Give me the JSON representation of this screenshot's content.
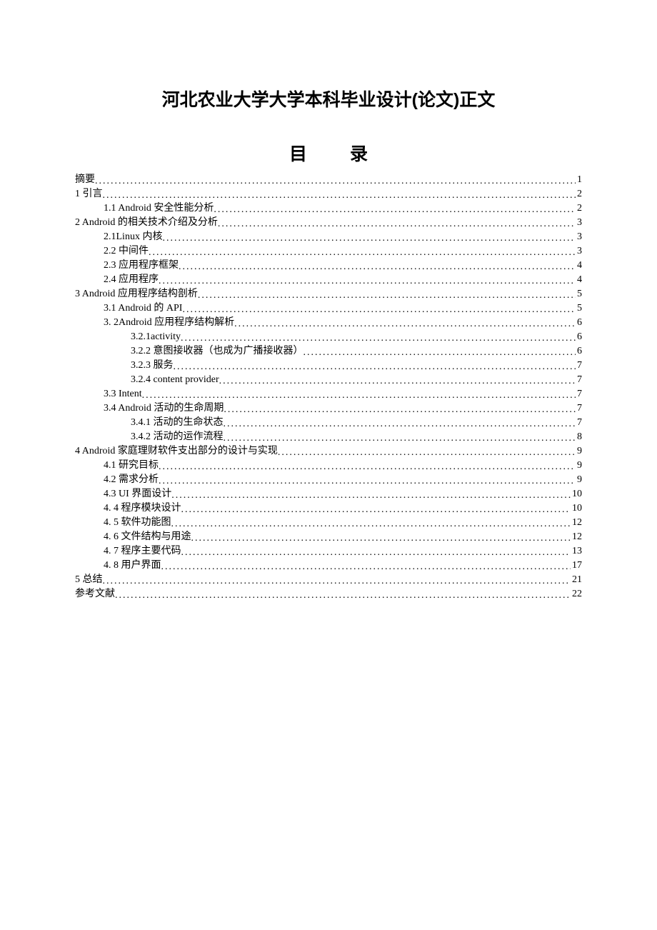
{
  "title": "河北农业大学大学本科毕业设计(论文)正文",
  "toc_heading_left": "目",
  "toc_heading_right": "录",
  "toc": [
    {
      "level": 0,
      "label": "摘要",
      "page": "1"
    },
    {
      "level": 0,
      "label": "1  引言",
      "page": "2"
    },
    {
      "level": 1,
      "label": "1.1 Android 安全性能分析 ",
      "page": "2"
    },
    {
      "level": 0,
      "label": "2 Android 的相关技术介绍及分析 ",
      "page": "3"
    },
    {
      "level": 1,
      "label": "2.1Linux 内核",
      "page": "3"
    },
    {
      "level": 1,
      "label": "2.2 中间件",
      "page": "3"
    },
    {
      "level": 1,
      "label": "2.3  应用程序框架",
      "page": "4"
    },
    {
      "level": 1,
      "label": "2.4 应用程序",
      "page": "4"
    },
    {
      "level": 0,
      "label": "3 Android 应用程序结构剖析 ",
      "page": "5"
    },
    {
      "level": 1,
      "label": "3.1 Android 的 API",
      "page": "5"
    },
    {
      "level": 1,
      "label": "3. 2Android 应用程序结构解析",
      "page": "6"
    },
    {
      "level": 2,
      "label": "3.2.1activity",
      "page": "6"
    },
    {
      "level": 2,
      "label": "3.2.2 意图接收器（也成为广播接收器）",
      "page": "6"
    },
    {
      "level": 2,
      "label": "3.2.3 服务",
      "page": "7"
    },
    {
      "level": 2,
      "label": "3.2.4  content provider",
      "page": "7"
    },
    {
      "level": 1,
      "label": "3.3 Intent ",
      "page": "7"
    },
    {
      "level": 1,
      "label": "3.4 Android 活动的生命周期 ",
      "page": "7"
    },
    {
      "level": 2,
      "label": "3.4.1 活动的生命状态",
      "page": "7"
    },
    {
      "level": 2,
      "label": "3.4.2  活动的运作流程",
      "page": "8"
    },
    {
      "level": 0,
      "label": "4    Android 家庭理财软件支出部分的设计与实现 ",
      "page": "9"
    },
    {
      "level": 1,
      "label": "4.1    研究目标",
      "page": "9"
    },
    {
      "level": 1,
      "label": "4.2    需求分析",
      "page": "9"
    },
    {
      "level": 1,
      "label": "4.3    UI 界面设计 ",
      "page": "10"
    },
    {
      "level": 1,
      "label": "4. 4    程序模块设计",
      "page": "10"
    },
    {
      "level": 1,
      "label": "4. 5    软件功能图",
      "page": "12"
    },
    {
      "level": 1,
      "label": "4. 6    文件结构与用途",
      "page": "12"
    },
    {
      "level": 1,
      "label": "4. 7 程序主要代码",
      "page": "13"
    },
    {
      "level": 1,
      "label": "4. 8    用户界面",
      "page": "17"
    },
    {
      "level": 0,
      "label": "5  总结",
      "page": "21"
    },
    {
      "level": 0,
      "label": "参考文献",
      "page": "22"
    }
  ]
}
